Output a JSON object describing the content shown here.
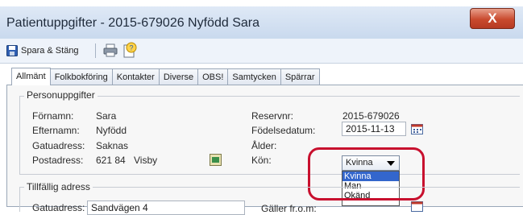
{
  "window": {
    "title": "Patientuppgifter - 2015-679026 Nyfödd Sara",
    "close_glyph": "X"
  },
  "toolbar": {
    "save_label": "Spara & Stäng"
  },
  "tabs": [
    "Allmänt",
    "Folkbokföring",
    "Kontakter",
    "Diverse",
    "OBS!",
    "Samtycken",
    "Spärrar"
  ],
  "personuppgifter": {
    "legend": "Personuppgifter",
    "fornamn": {
      "label": "Förnamn:",
      "value": "Sara"
    },
    "efternamn": {
      "label": "Efternamn:",
      "value": "Nyfödd"
    },
    "gatuadress": {
      "label": "Gatuadress:",
      "value": "Saknas"
    },
    "postadress": {
      "label": "Postadress:",
      "postnr": "621 84",
      "ort": "Visby"
    },
    "reservnr": {
      "label": "Reservnr:",
      "value": "2015-679026"
    },
    "fodelsedatum": {
      "label": "Födelsedatum:",
      "value": "2015-11-13"
    },
    "alder": {
      "label": "Ålder:",
      "value": ""
    },
    "kon": {
      "label": "Kön:",
      "selected": "Kvinna",
      "options": [
        "Kvinna",
        "Man",
        "Okänd"
      ]
    }
  },
  "tillfallig_adress": {
    "legend": "Tillfällig adress",
    "gatuadress_label": "Gatuadress:",
    "gatuadress_value": "Sandvägen 4",
    "galler_label": "Gäller fr.o.m:"
  },
  "colors": {
    "highlight": "#c8102e",
    "selection": "#3366cc",
    "close_button": "#c94a2e"
  }
}
